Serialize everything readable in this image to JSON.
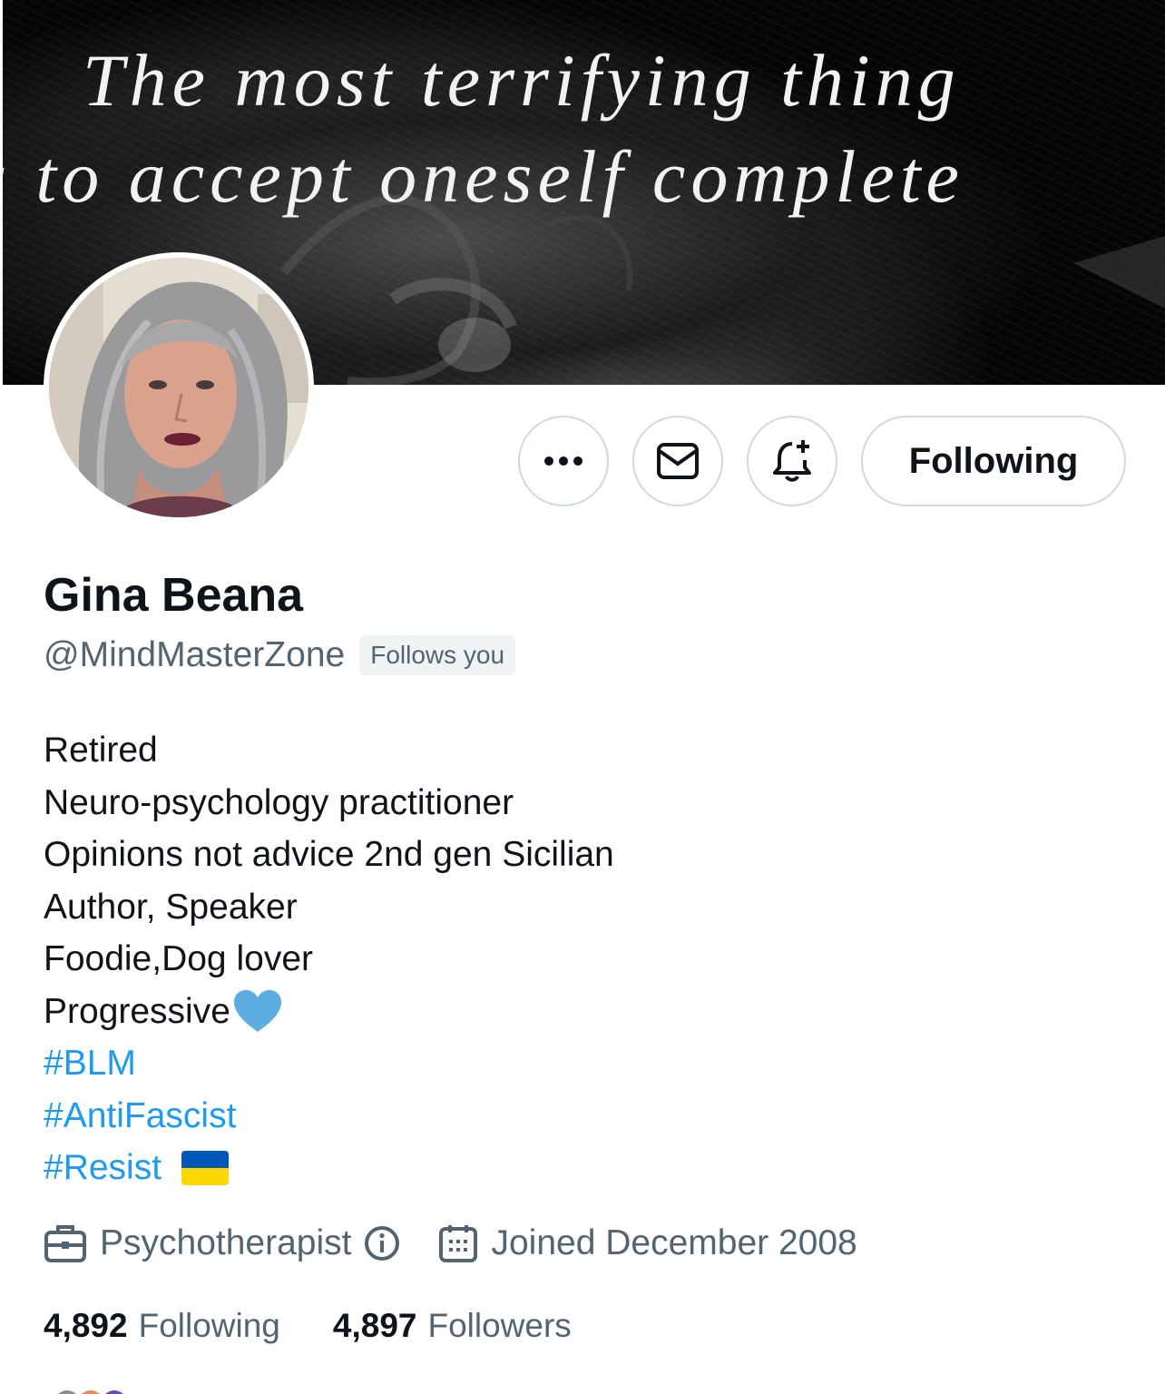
{
  "banner": {
    "line1": "The most terrifying thing",
    "line2": "s to accept oneself complete"
  },
  "profile": {
    "display_name": "Gina Beana",
    "handle": "@MindMasterZone",
    "follows_you_badge": "Follows you"
  },
  "actions": {
    "more_icon": "more-dots-icon",
    "message_icon": "envelope-icon",
    "notify_icon": "bell-plus-icon",
    "following_label": "Following"
  },
  "bio": {
    "lines": [
      "Retired",
      "Neuro-psychology practitioner",
      "Opinions not advice 2nd gen Sicilian",
      "Author, Speaker",
      "Foodie,Dog lover",
      "Progressive"
    ],
    "hashtags": [
      "#BLM",
      "#AntiFascist",
      "#Resist"
    ],
    "emoji_heart": "blue-heart",
    "emoji_flag": "ukraine-flag"
  },
  "meta": {
    "profession": "Psychotherapist",
    "joined": "Joined December 2008"
  },
  "stats": {
    "following_count": "4,892",
    "following_label": "Following",
    "followers_count": "4,897",
    "followers_label": "Followers"
  },
  "colors": {
    "text_primary": "#0f1419",
    "text_secondary": "#536471",
    "link": "#1d9bf0",
    "border": "#cfd9de",
    "heart": "#5dade2",
    "flag_blue": "#0057b7",
    "flag_yellow": "#ffd700"
  }
}
